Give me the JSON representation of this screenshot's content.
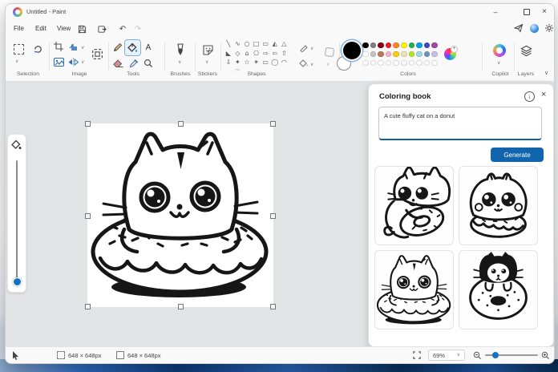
{
  "window": {
    "title": "Untitled - Paint",
    "controls": {
      "minimize": "–",
      "close": "×"
    }
  },
  "icons": {
    "chevron": "∨",
    "info": "i",
    "undo": "↶",
    "redo": "↷",
    "text_tool": "A"
  },
  "menubar": {
    "items": {
      "file": "File",
      "edit": "Edit",
      "view": "View"
    }
  },
  "ribbon": {
    "selection": {
      "label": "Selection"
    },
    "image": {
      "label": "Image"
    },
    "tools": {
      "label": "Tools",
      "selected_tool": "fill"
    },
    "brushes": {
      "label": "Brushes"
    },
    "stickers": {
      "label": "Stickers"
    },
    "shapes": {
      "label": "Shapes",
      "glyphs": [
        "╲",
        "∿",
        "○",
        "□",
        "▭",
        "◭",
        "△",
        "◣",
        "◇",
        "⌂",
        "⎔",
        "⇨",
        "⇦",
        "⇧",
        "⇩",
        "✦",
        "☆",
        "✶",
        "▭",
        "◯",
        "◠",
        "◡",
        "♡"
      ]
    },
    "colors": {
      "label": "Colors",
      "foreground": "#000000",
      "background": "#ffffff",
      "row1": [
        "#000000",
        "#7f7f7f",
        "#880015",
        "#ed1c24",
        "#ff7f27",
        "#fff200",
        "#22b14c",
        "#00a2e8",
        "#3f48cc",
        "#a349a4"
      ],
      "row2": [
        "#ffffff",
        "#c3c3c3",
        "#b97a57",
        "#ffaec9",
        "#ffc90e",
        "#efe4b0",
        "#b5e61d",
        "#99d9ea",
        "#7092be",
        "#c8bfe7"
      ],
      "empty_slots": 10
    },
    "copilot": {
      "label": "Copilot"
    },
    "layers": {
      "label": "Layers"
    }
  },
  "coloring_book": {
    "title": "Coloring book",
    "prompt": "A cute fluffy cat on a donut",
    "generate_label": "Generate",
    "thumbnails": [
      {
        "name": "cat-hugging-donut"
      },
      {
        "name": "fluffy-cat-in-donut"
      },
      {
        "name": "cat-head-on-donut"
      },
      {
        "name": "tuxedo-cat-behind-donut"
      }
    ]
  },
  "statusbar": {
    "selection_size": "648 × 648px",
    "canvas_size": "648 × 648px",
    "zoom_level": "69%"
  }
}
